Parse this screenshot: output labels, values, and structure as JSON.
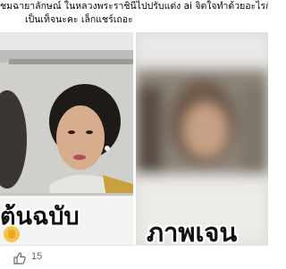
{
  "post": {
    "text_line1": "ชมฉายาลักษณ์ ในหลวงพระราชินีไปปรับแต่ง ai จิตใจทำด้วยอะไรกัน!! ห",
    "text_line2": "เป็นเท็จนะคะ เล็กแชร์เถอะ"
  },
  "images": {
    "left": {
      "caption": "ต้นฉบับ",
      "icon": "hand-emoji-icon"
    },
    "right": {
      "caption": "ภาพเจน"
    }
  },
  "reactions": {
    "like_count": "15",
    "icon": "thumbs-up-icon"
  }
}
